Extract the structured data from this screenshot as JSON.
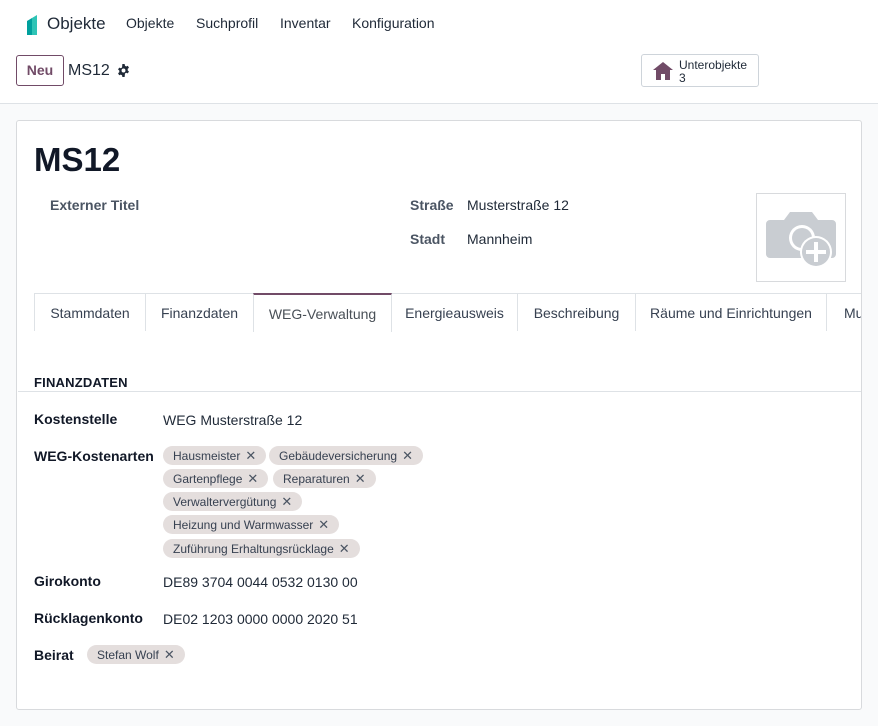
{
  "app": {
    "name": "Objekte",
    "brand_color": "#00A09D"
  },
  "nav": [
    "Objekte",
    "Suchprofil",
    "Inventar",
    "Konfiguration"
  ],
  "control": {
    "new_label": "Neu",
    "record_name": "MS12"
  },
  "smart_button": {
    "label": "Unterobjekte",
    "count": "3",
    "icon": "house-icon"
  },
  "record": {
    "title": "MS12",
    "external_title_label": "Externer Titel",
    "street_label": "Straße",
    "street_value": "Musterstraße 12",
    "city_label": "Stadt",
    "city_value": "Mannheim",
    "photo_icon": "camera-add-icon"
  },
  "tabs": [
    "Stammdaten",
    "Finanzdaten",
    "WEG-Verwaltung",
    "Energieausweis",
    "Beschreibung",
    "Räume und Einrichtungen",
    "Mu"
  ],
  "active_tab": "WEG-Verwaltung",
  "section": {
    "title": "FINANZDATEN",
    "kostenstelle_label": "Kostenstelle",
    "kostenstelle_value": "WEG Musterstraße 12",
    "kostenarten_label": "WEG-Kostenarten",
    "kostenarten": [
      "Hausmeister",
      "Gebäudeversicherung",
      "Gartenpflege",
      "Reparaturen",
      "Verwaltervergütung",
      "Heizung und Warmwasser",
      "Zuführung Erhaltungsrücklage"
    ],
    "girokonto_label": "Girokonto",
    "girokonto_value": "DE89 3704 0044 0532 0130 00",
    "ruecklagen_label": "Rücklagenkonto",
    "ruecklagen_value": "DE02 1203 0000 0000 2020 51",
    "beirat_label": "Beirat",
    "beirat": [
      "Stefan Wolf"
    ]
  },
  "colors": {
    "accent": "#714B67",
    "tag_bg": "#E4DEDD"
  }
}
